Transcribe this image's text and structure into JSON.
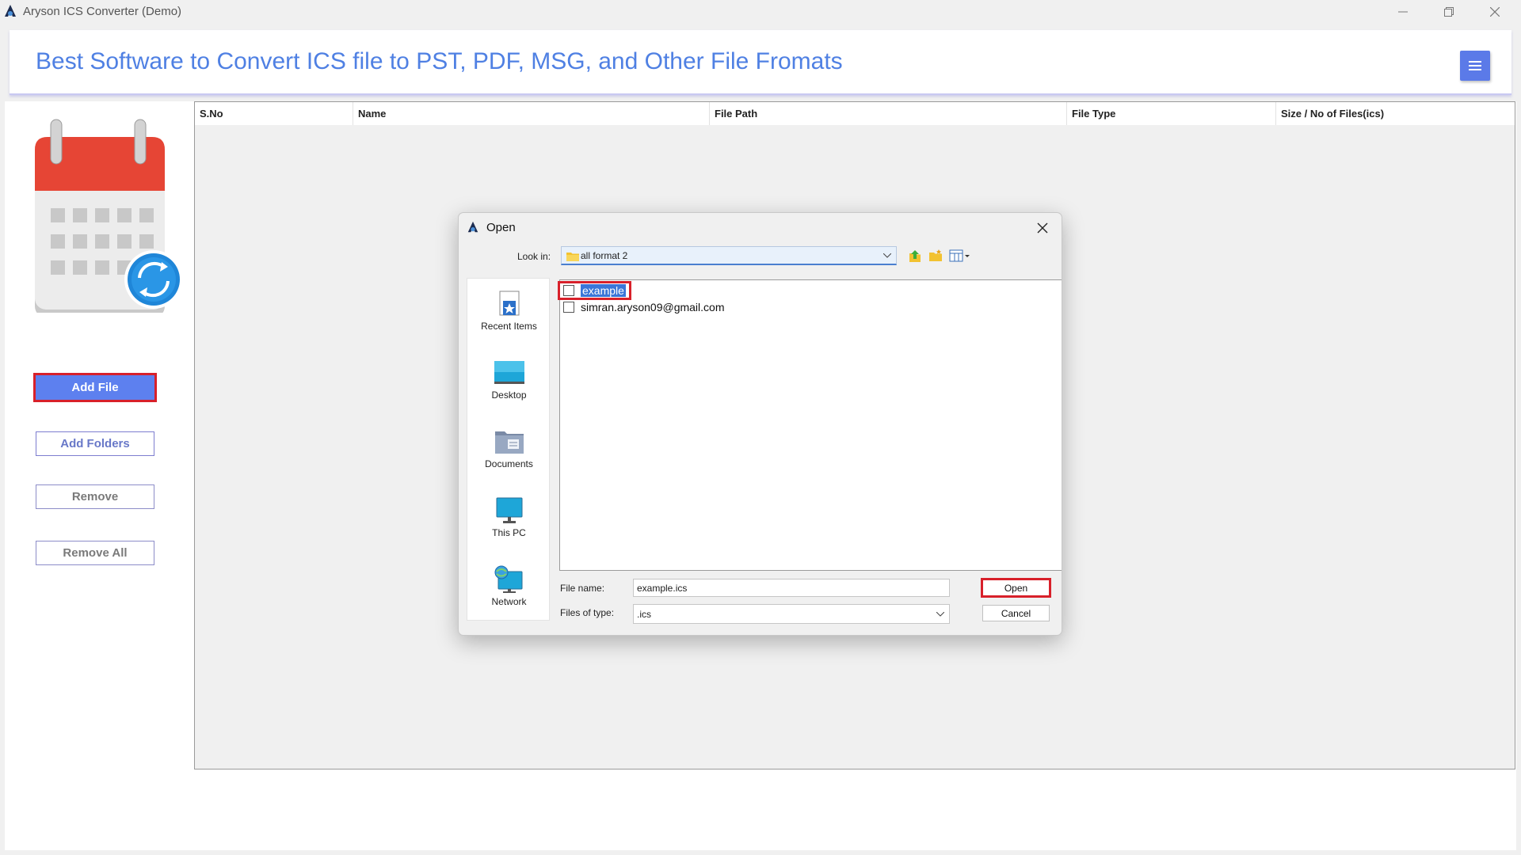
{
  "window": {
    "title": "Aryson ICS Converter (Demo)"
  },
  "header": {
    "headline": "Best Software to Convert ICS file to PST, PDF, MSG, and Other File Fromats"
  },
  "sidebar": {
    "buttons": [
      {
        "label": "Add File"
      },
      {
        "label": "Add Folders"
      },
      {
        "label": "Remove"
      },
      {
        "label": "Remove All"
      }
    ]
  },
  "table": {
    "columns": [
      "S.No",
      "Name",
      "File Path",
      "File Type",
      "Size / No of Files(ics)"
    ]
  },
  "dialog": {
    "title": "Open",
    "look_in_label": "Look in:",
    "look_in_value": "all format 2",
    "places": [
      "Recent Items",
      "Desktop",
      "Documents",
      "This PC",
      "Network"
    ],
    "files": [
      "example",
      "simran.aryson09@gmail.com"
    ],
    "selected_file": "example",
    "file_name_label": "File name:",
    "file_name_value": "example.ics",
    "file_type_label": "Files of type:",
    "file_type_value": ".ics",
    "open_label": "Open",
    "cancel_label": "Cancel"
  },
  "colors": {
    "accent": "#5d80ef",
    "headline": "#4f80e3",
    "highlight": "#d8202a",
    "selection": "#3a76d8"
  }
}
